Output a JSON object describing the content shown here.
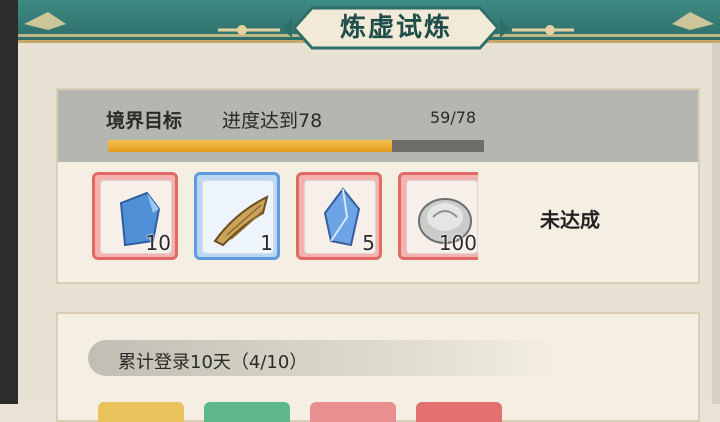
{
  "header": {
    "title": "炼虚试炼"
  },
  "task_1": {
    "realm_label": "境界目标",
    "goal_text": "进度达到78",
    "progress_text": "59/78",
    "progress": {
      "current": 59,
      "target": 78
    },
    "status": "未达成",
    "rewards": [
      {
        "icon": "blue-cloth-icon",
        "quantity": "10",
        "rarity": "red"
      },
      {
        "icon": "golden-fan-icon",
        "quantity": "1",
        "rarity": "blue"
      },
      {
        "icon": "blue-crystal-icon",
        "quantity": "5",
        "rarity": "red"
      },
      {
        "icon": "silver-coin-icon",
        "quantity": "100",
        "rarity": "red"
      }
    ]
  },
  "task_2": {
    "label": "累计登录10天（4/10）"
  },
  "colors": {
    "teal_banner": "#2f6f6a",
    "gold_trim": "#c8a86a",
    "progress_fill": "#f0b33a",
    "red_frame": "#e26a65",
    "blue_frame": "#5e9be0"
  }
}
